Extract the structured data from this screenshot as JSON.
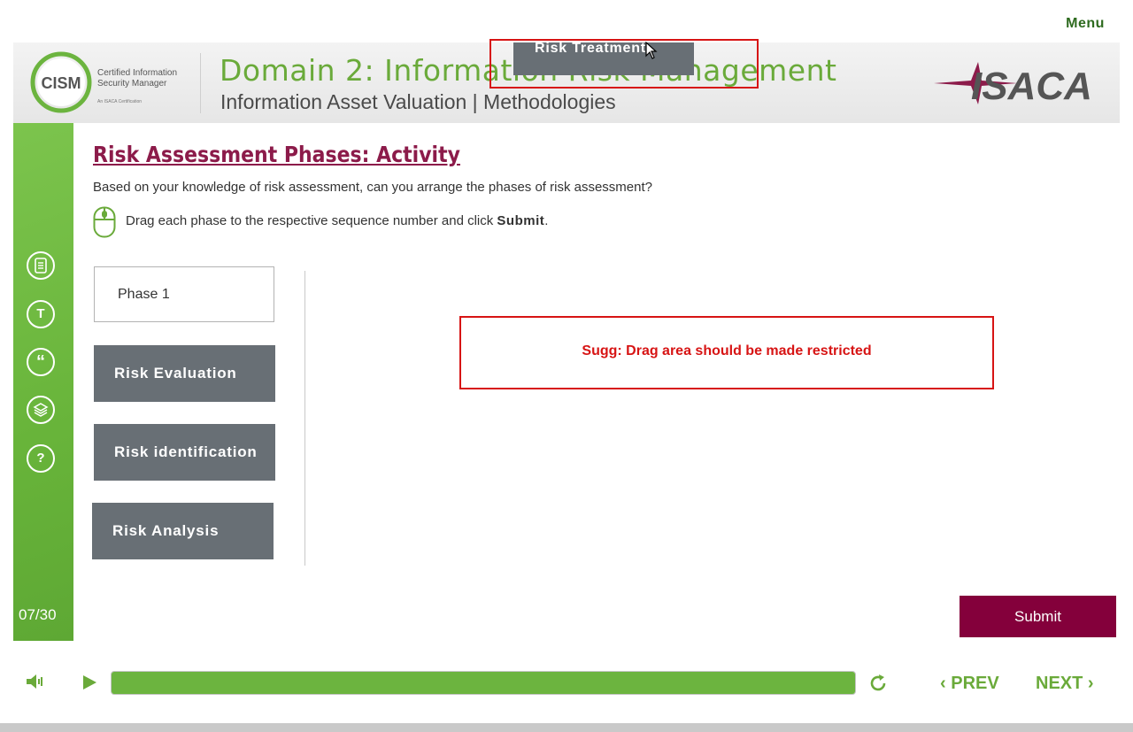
{
  "top": {
    "menu_label": "Menu"
  },
  "header": {
    "cism_logo_text": "CISM",
    "cism_line1": "Certified Information",
    "cism_line2": "Security Manager",
    "cism_tagline": "An ISACA Certification",
    "title": "Domain 2: Information Risk Management",
    "subtitle": "Information Asset Valuation | Methodologies",
    "isaca_logo_text": "ISACA",
    "colors": {
      "title": "#6aaa3a",
      "band": "#e6e6e6"
    }
  },
  "sidebar": {
    "icons": [
      {
        "name": "notes-icon",
        "glyph": ""
      },
      {
        "name": "transcript-icon",
        "glyph": "T"
      },
      {
        "name": "quote-icon",
        "glyph": "“"
      },
      {
        "name": "resources-icon",
        "glyph": ""
      },
      {
        "name": "help-icon",
        "glyph": "?"
      }
    ],
    "page_counter": "07/30",
    "color": "#68b43a"
  },
  "activity": {
    "title": "Risk Assessment Phases: Activity",
    "question": "Based on your knowledge of risk assessment, can you arrange the phases of risk assessment?",
    "instruction_prefix": "Drag each phase to the respective sequence number and click ",
    "instruction_bold": "Submit",
    "instruction_suffix": ".",
    "drop_slot_label": "Phase 1",
    "drag_items": [
      "Risk Evaluation",
      "Risk identification",
      "Risk Analysis"
    ],
    "dragging_item": "Risk Treatment",
    "submit_label": "Submit",
    "accent_color": "#84003b"
  },
  "annotation": {
    "note": "Sugg: Drag area should be made restricted",
    "color": "#d71414"
  },
  "player": {
    "progress_fraction": 1.0,
    "prev_label": "PREV",
    "next_label": "NEXT",
    "prev_chevron": "‹",
    "next_chevron": "›"
  }
}
